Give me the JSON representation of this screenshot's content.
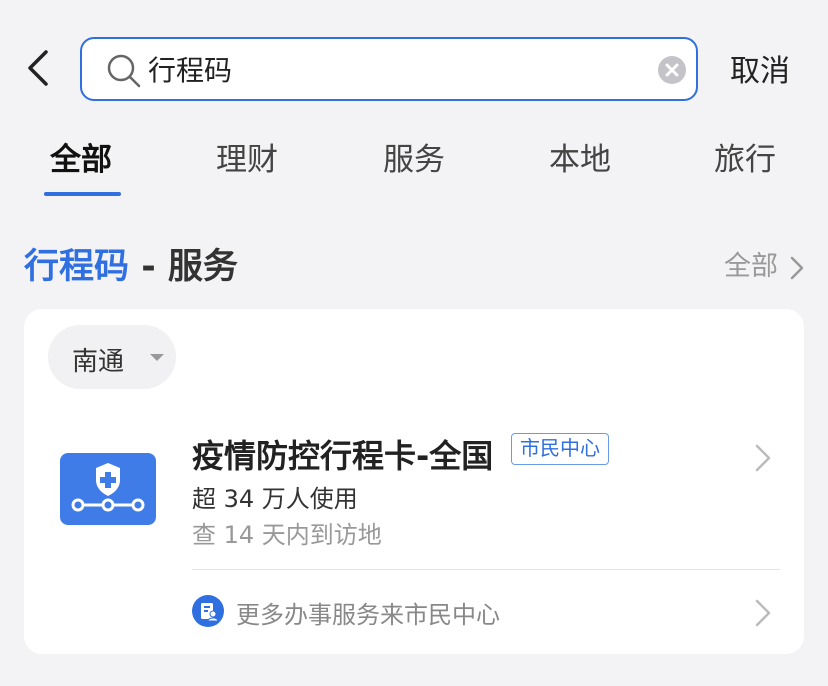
{
  "search": {
    "value": "行程码",
    "cancel_label": "取消"
  },
  "tabs": [
    {
      "label": "全部",
      "active": true
    },
    {
      "label": "理财"
    },
    {
      "label": "服务"
    },
    {
      "label": "本地"
    },
    {
      "label": "旅行"
    }
  ],
  "section": {
    "keyword": "行程码",
    "suffix": " - 服务",
    "see_all_label": "全部"
  },
  "card": {
    "city": "南通",
    "item": {
      "title": "疫情防控行程卡-全国",
      "badge": "市民中心",
      "users": "超 34 万人使用",
      "desc": "查 14 天内到访地"
    },
    "more_label": "更多办事服务来市民中心"
  },
  "colors": {
    "accent": "#2f6fe0",
    "background": "#f3f3f5"
  }
}
